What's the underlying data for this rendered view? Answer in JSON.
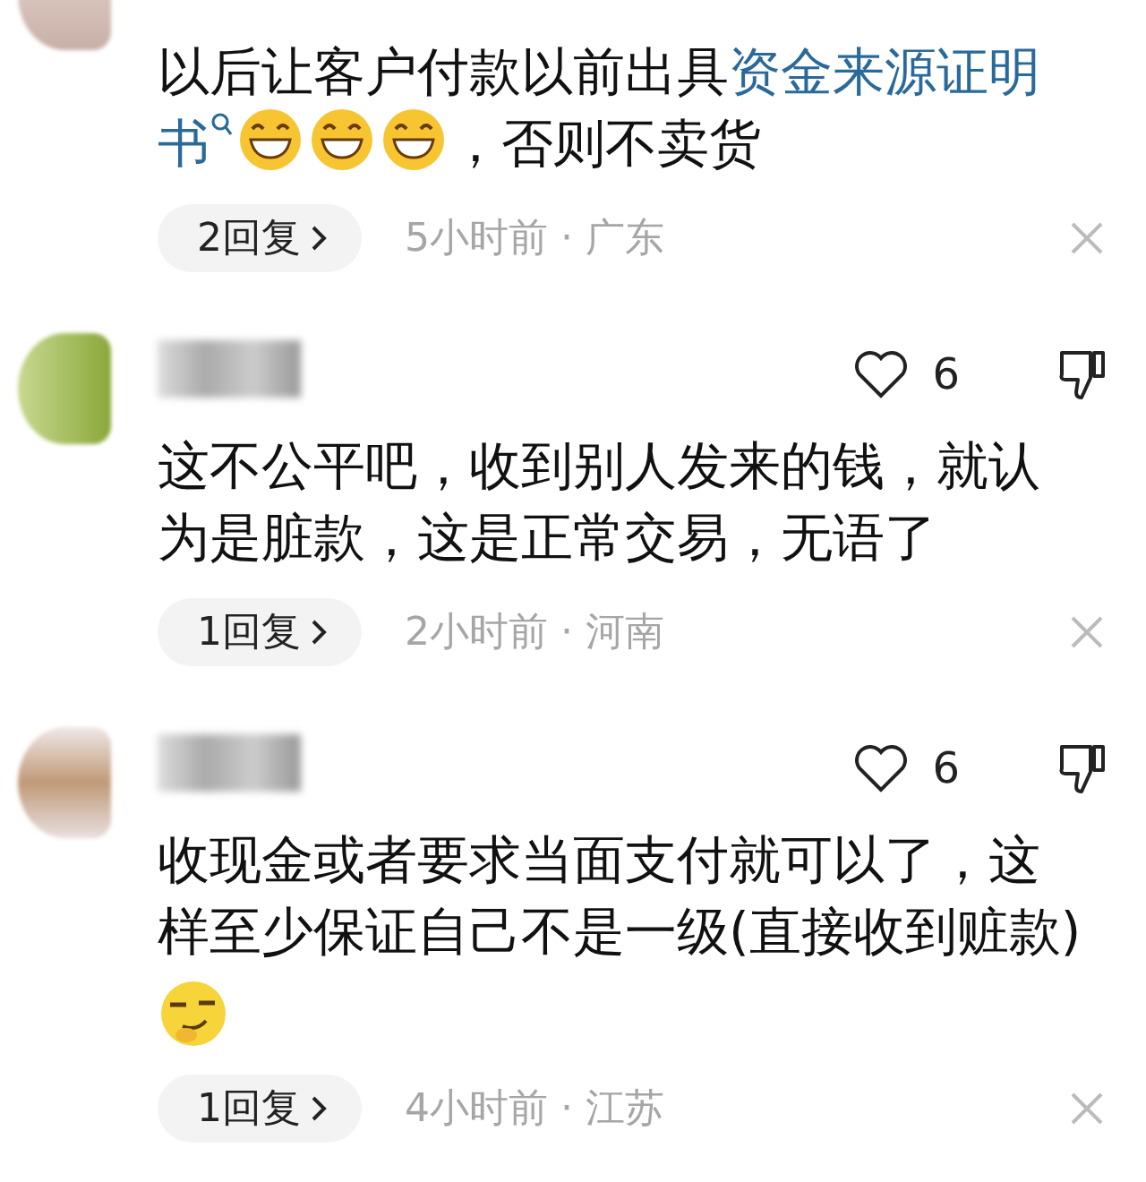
{
  "comments": [
    {
      "body": [
        {
          "kind": "text",
          "text": "以后让客户付款以前出具"
        },
        {
          "kind": "link",
          "text": "资金来源证明"
        },
        {
          "kind": "link",
          "text": "书"
        },
        {
          "kind": "grin"
        },
        {
          "kind": "grin"
        },
        {
          "kind": "grin"
        },
        {
          "kind": "text",
          "text": "，否则不卖货"
        }
      ],
      "replies": "2回复",
      "meta": "5小时前 · 广东"
    },
    {
      "likes": "6",
      "body": [
        {
          "kind": "text",
          "text": "这不公平吧，收到别人发来的钱，就认为是脏款，这是正常交易，无语了"
        }
      ],
      "replies": "1回复",
      "meta": "2小时前 · 河南"
    },
    {
      "likes": "6",
      "body": [
        {
          "kind": "text",
          "text": "收现金或者要求当面支付就可以了，这样至少保证自己不是一级(直接收到赃款)"
        },
        {
          "kind": "smirk"
        }
      ],
      "replies": "1回复",
      "meta": "4小时前 · 江苏"
    }
  ]
}
